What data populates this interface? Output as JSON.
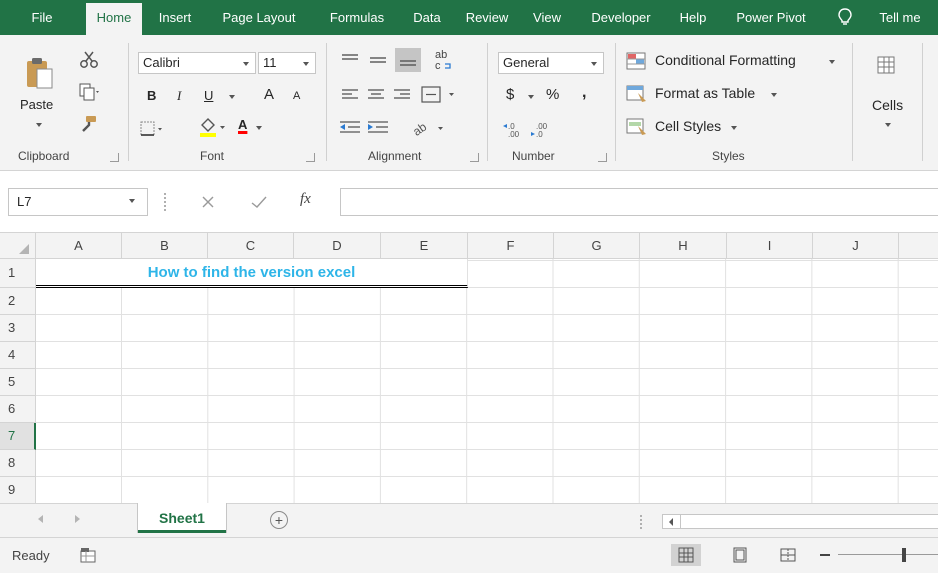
{
  "ribbon_tabs": [
    {
      "label": "File",
      "active": false
    },
    {
      "label": "Home",
      "active": true
    },
    {
      "label": "Insert",
      "active": false
    },
    {
      "label": "Page Layout",
      "active": false
    },
    {
      "label": "Formulas",
      "active": false
    },
    {
      "label": "Data",
      "active": false
    },
    {
      "label": "Review",
      "active": false
    },
    {
      "label": "View",
      "active": false
    },
    {
      "label": "Developer",
      "active": false
    },
    {
      "label": "Help",
      "active": false
    },
    {
      "label": "Power Pivot",
      "active": false
    },
    {
      "label": "Tell me",
      "active": false
    }
  ],
  "clipboard": {
    "paste_label": "Paste",
    "group_label": "Clipboard"
  },
  "font": {
    "name": "Calibri",
    "size": "11",
    "group_label": "Font",
    "bold": "B",
    "italic": "I",
    "underline": "U",
    "grow": "A",
    "shrink": "A",
    "font_color_glyph": "A"
  },
  "alignment": {
    "group_label": "Alignment"
  },
  "number": {
    "format": "General",
    "currency": "$",
    "percent": "%",
    "comma": ",",
    "group_label": "Number"
  },
  "styles": {
    "conditional_formatting": "Conditional Formatting",
    "format_as_table": "Format as Table",
    "cell_styles": "Cell Styles",
    "group_label": "Styles"
  },
  "cells": {
    "label": "Cells"
  },
  "formula_bar": {
    "name_box": "L7",
    "fx": "fx",
    "formula": ""
  },
  "grid": {
    "columns": [
      "A",
      "B",
      "C",
      "D",
      "E",
      "F",
      "G",
      "H",
      "I",
      "J"
    ],
    "rows": [
      "1",
      "2",
      "3",
      "4",
      "5",
      "6",
      "7",
      "8",
      "9"
    ],
    "selected_row": "7",
    "title_text": "How to find the version excel",
    "title_color": "#2eb5e8"
  },
  "sheets": {
    "tabs": [
      "Sheet1"
    ],
    "active": "Sheet1"
  },
  "status": {
    "ready": "Ready"
  },
  "colors": {
    "accent": "#217346"
  }
}
